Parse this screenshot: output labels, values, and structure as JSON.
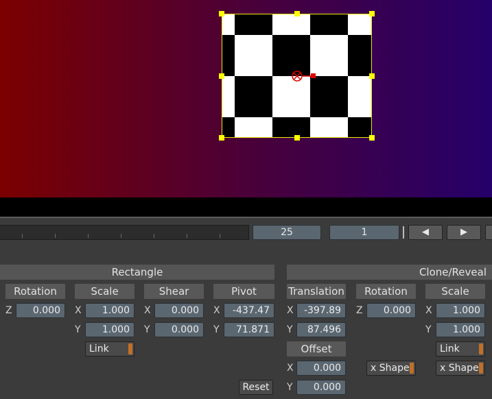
{
  "timeline": {
    "current_frame": "25",
    "frame_step": "1",
    "prev_label": "◀",
    "next_label": "▶"
  },
  "rectangle": {
    "title": "Rectangle",
    "rotation": {
      "label": "Rotation",
      "z_axis": "Z",
      "z": "0.000"
    },
    "scale": {
      "label": "Scale",
      "x_axis": "X",
      "y_axis": "Y",
      "x": "1.000",
      "y": "1.000",
      "link_label": "Link"
    },
    "shear": {
      "label": "Shear",
      "x_axis": "X",
      "y_axis": "Y",
      "x": "0.000",
      "y": "0.000"
    },
    "pivot": {
      "label": "Pivot",
      "x_axis": "X",
      "y_axis": "Y",
      "x": "-437.47",
      "y": "71.871"
    },
    "reset_label": "Reset"
  },
  "clone_reveal": {
    "title": "Clone/Reveal",
    "translation": {
      "label": "Translation",
      "x_axis": "X",
      "y_axis": "Y",
      "x": "-397.89",
      "y": "87.496"
    },
    "offset": {
      "label": "Offset",
      "x_axis": "X",
      "y_axis": "Y",
      "x": "0.000",
      "y": "0.000"
    },
    "rotation": {
      "label": "Rotation",
      "z_axis": "Z",
      "z": "0.000",
      "shape_label": "x Shape"
    },
    "scale": {
      "label": "Scale",
      "x_axis": "X",
      "y_axis": "Y",
      "x": "1.000",
      "y": "1.000",
      "link_label": "Link",
      "shape_label": "x Shape"
    }
  },
  "colors": {
    "handle": "#ffff00",
    "pivot_marker": "#e00000",
    "field_bg": "#5a6670",
    "toggle_led": "#c07028"
  }
}
